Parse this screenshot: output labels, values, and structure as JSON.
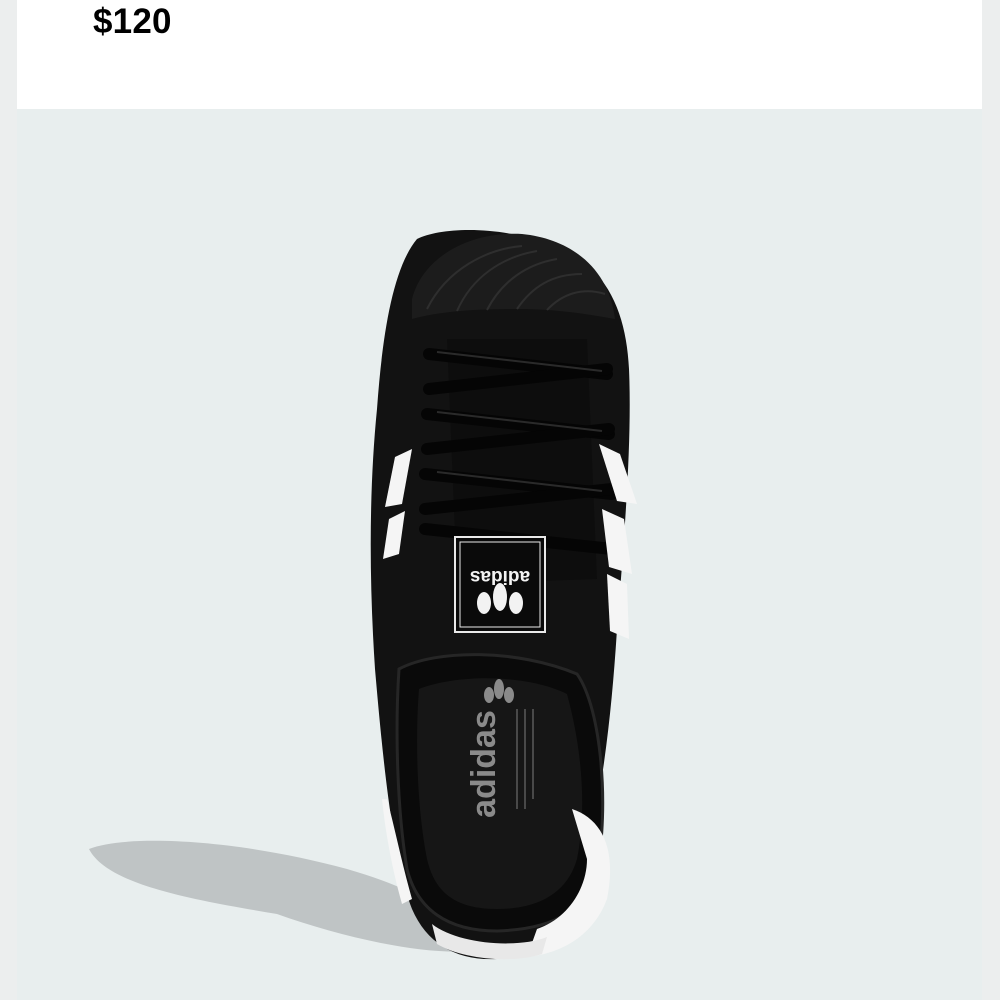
{
  "product": {
    "price": "$120",
    "image": {
      "subject": "black-sneaker-top-view",
      "brand_text": "adidas",
      "background_color": "#e8eeee",
      "shoe_color": "#101010",
      "stripe_color": "#ffffff"
    }
  }
}
